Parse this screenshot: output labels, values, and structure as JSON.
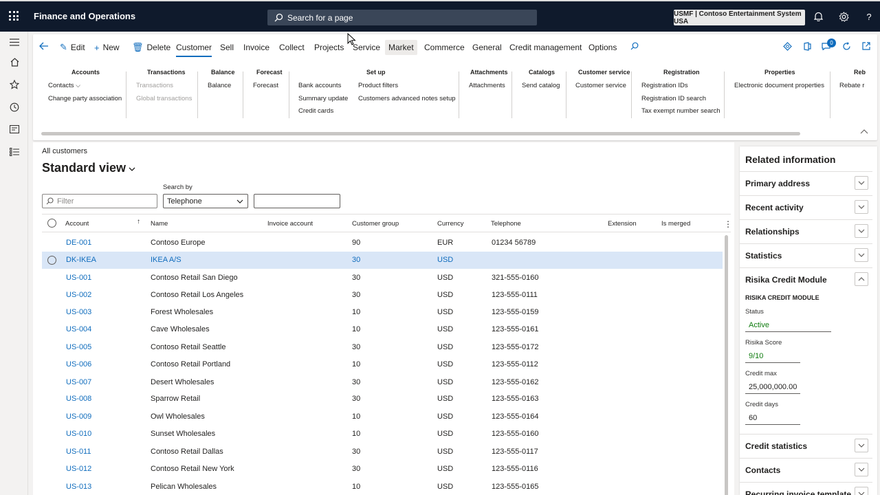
{
  "topbar": {
    "app_title": "Finance and Operations",
    "search_placeholder": "Search for a page",
    "company": "USMF | Contoso Entertainment System USA"
  },
  "actionpane": {
    "commands": {
      "edit": "Edit",
      "new": "New",
      "delete": "Delete"
    },
    "tabs": [
      "Customer",
      "Sell",
      "Invoice",
      "Collect",
      "Projects",
      "Service",
      "Market",
      "Commerce",
      "General",
      "Credit management",
      "Options"
    ],
    "active_tab": "Customer",
    "badge_count": "0",
    "groups": {
      "accounts": {
        "title": "Accounts",
        "items": [
          "Contacts",
          "Change party association"
        ]
      },
      "transactions": {
        "title": "Transactions",
        "items": [
          "Transactions",
          "Global transactions"
        ]
      },
      "balance": {
        "title": "Balance",
        "items": [
          "Balance"
        ]
      },
      "forecast": {
        "title": "Forecast",
        "items": [
          "Forecast"
        ]
      },
      "setup": {
        "title": "Set up",
        "items": [
          "Bank accounts",
          "Summary update",
          "Credit cards",
          "Product filters",
          "Customers advanced notes setup"
        ]
      },
      "attachments": {
        "title": "Attachments",
        "items": [
          "Attachments"
        ]
      },
      "catalogs": {
        "title": "Catalogs",
        "items": [
          "Send catalog"
        ]
      },
      "customer_service": {
        "title": "Customer service",
        "items": [
          "Customer service"
        ]
      },
      "registration": {
        "title": "Registration",
        "items": [
          "Registration IDs",
          "Registration ID search",
          "Tax exempt number search"
        ]
      },
      "properties": {
        "title": "Properties",
        "items": [
          "Electronic document properties"
        ]
      },
      "rebate": {
        "title": "Reb",
        "items": [
          "Rebate r"
        ]
      }
    }
  },
  "main": {
    "breadcrumb": "All customers",
    "view_title": "Standard view",
    "filter_placeholder": "Filter",
    "search_by_label": "Search by",
    "search_by_value": "Telephone",
    "columns": [
      "Account",
      "Name",
      "Invoice account",
      "Customer group",
      "Currency",
      "Telephone",
      "Extension",
      "Is merged"
    ],
    "rows": [
      {
        "account": "DE-001",
        "name": "Contoso Europe",
        "group": "90",
        "currency": "EUR",
        "phone": "01234 56789"
      },
      {
        "account": "DK-IKEA",
        "name": "IKEA A/S",
        "group": "30",
        "currency": "USD",
        "phone": ""
      },
      {
        "account": "US-001",
        "name": "Contoso Retail San Diego",
        "group": "30",
        "currency": "USD",
        "phone": "321-555-0160"
      },
      {
        "account": "US-002",
        "name": "Contoso Retail Los Angeles",
        "group": "30",
        "currency": "USD",
        "phone": "123-555-0111"
      },
      {
        "account": "US-003",
        "name": "Forest Wholesales",
        "group": "10",
        "currency": "USD",
        "phone": "123-555-0159"
      },
      {
        "account": "US-004",
        "name": "Cave Wholesales",
        "group": "10",
        "currency": "USD",
        "phone": "123-555-0161"
      },
      {
        "account": "US-005",
        "name": "Contoso Retail Seattle",
        "group": "30",
        "currency": "USD",
        "phone": "123-555-0172"
      },
      {
        "account": "US-006",
        "name": "Contoso Retail Portland",
        "group": "10",
        "currency": "USD",
        "phone": "123-555-0112"
      },
      {
        "account": "US-007",
        "name": "Desert Wholesales",
        "group": "30",
        "currency": "USD",
        "phone": "123-555-0162"
      },
      {
        "account": "US-008",
        "name": "Sparrow Retail",
        "group": "30",
        "currency": "USD",
        "phone": "123-555-0163"
      },
      {
        "account": "US-009",
        "name": "Owl Wholesales",
        "group": "10",
        "currency": "USD",
        "phone": "123-555-0164"
      },
      {
        "account": "US-010",
        "name": "Sunset Wholesales",
        "group": "10",
        "currency": "USD",
        "phone": "123-555-0160"
      },
      {
        "account": "US-011",
        "name": "Contoso Retail Dallas",
        "group": "30",
        "currency": "USD",
        "phone": "123-555-0117"
      },
      {
        "account": "US-012",
        "name": "Contoso Retail New York",
        "group": "30",
        "currency": "USD",
        "phone": "123-555-0116"
      },
      {
        "account": "US-013",
        "name": "Pelican Wholesales",
        "group": "10",
        "currency": "USD",
        "phone": "123-555-0165"
      }
    ]
  },
  "related": {
    "title": "Related information",
    "sections": [
      "Primary address",
      "Recent activity",
      "Relationships",
      "Statistics",
      "Risika Credit Module"
    ],
    "risika": {
      "heading": "RISIKA CREDIT MODULE",
      "status_label": "Status",
      "status_value": "Active",
      "score_label": "Risika Score",
      "score_value": "9/10",
      "credit_max_label": "Credit max",
      "credit_max_value": "25,000,000.00",
      "credit_days_label": "Credit days",
      "credit_days_value": "60"
    },
    "bottom_sections": [
      "Credit statistics",
      "Contacts",
      "Recurring invoice template"
    ]
  },
  "colors": {
    "topbar": "#0f1a2c",
    "accent": "#0f6cbd",
    "selected_row": "#d9e6f7",
    "green": "#107c10"
  }
}
